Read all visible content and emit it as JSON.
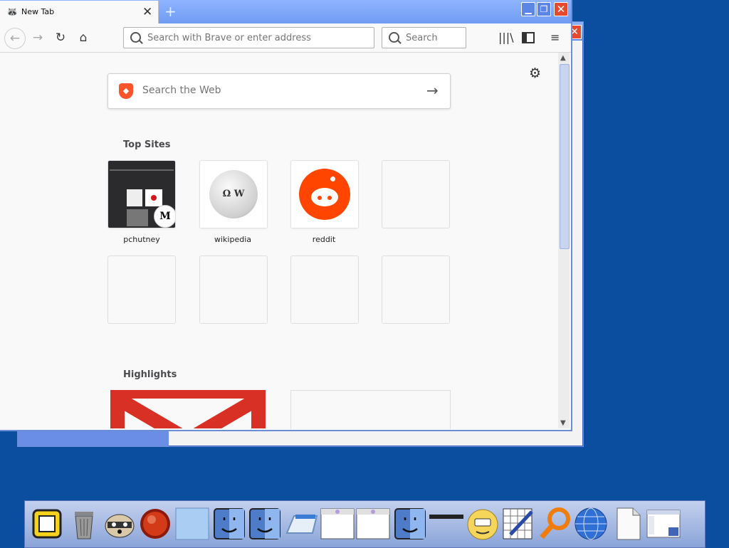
{
  "browser": {
    "tab": {
      "title": "New Tab",
      "close": "✕"
    },
    "new_tab": "+",
    "window_buttons": {
      "minimize": "▁",
      "restore": "❐",
      "close": "✕"
    },
    "toolbar": {
      "back": "←",
      "forward": "→",
      "reload": "↻",
      "home": "⌂",
      "address_placeholder": "Search with Brave or enter address",
      "search_placeholder": "Search",
      "menu": "≡"
    }
  },
  "newtab": {
    "settings": "⚙",
    "web_search_placeholder": "Search the Web",
    "web_search_submit": "→",
    "top_sites_label": "Top Sites",
    "top_sites": [
      {
        "label": "pchutney"
      },
      {
        "label": "wikipedia"
      },
      {
        "label": "reddit"
      },
      {
        "label": ""
      },
      {
        "label": ""
      },
      {
        "label": ""
      },
      {
        "label": ""
      },
      {
        "label": ""
      }
    ],
    "highlights_label": "Highlights"
  },
  "colors": {
    "desktop": "#0b4ea0",
    "titlebar": "#6f9bf2",
    "brave": "#fb542b",
    "reddit": "#ff4500",
    "gmail": "#d93025"
  },
  "dock_icons": [
    "finder-folder-icon",
    "trash-icon",
    "raccoon-icon",
    "red-orb-icon",
    "blank-window-icon",
    "finder-icon",
    "finder-icon",
    "mail-icon",
    "window-icon",
    "window-icon",
    "finder-icon",
    "divider-icon",
    "smiley-icon",
    "pen-grid-icon",
    "magnifier-icon",
    "globe-icon",
    "document-icon",
    "window-icon"
  ]
}
